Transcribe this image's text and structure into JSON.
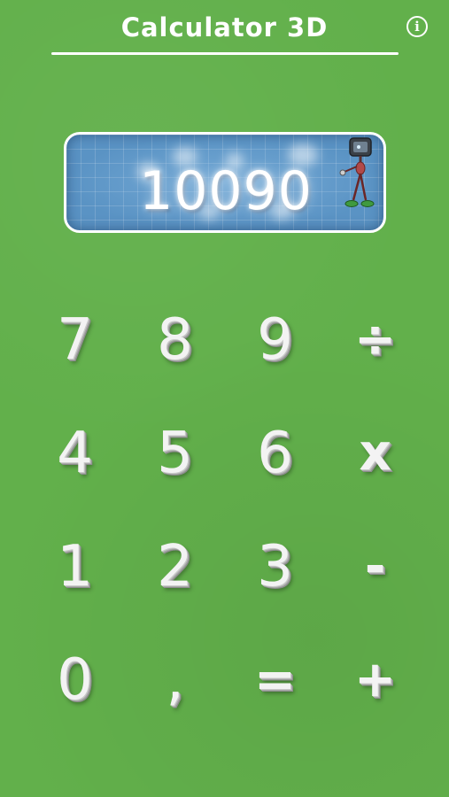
{
  "header": {
    "title": "Calculator 3D",
    "info_label": "i"
  },
  "display": {
    "value": "10090"
  },
  "keypad": {
    "rows": [
      [
        "7",
        "8",
        "9",
        "÷"
      ],
      [
        "4",
        "5",
        "6",
        "x"
      ],
      [
        "1",
        "2",
        "3",
        "-"
      ],
      [
        "0",
        ",",
        "=",
        "+"
      ]
    ]
  },
  "colors": {
    "background": "#62b04b",
    "display_background": "#5a93c4",
    "key_text": "#f3f3f3",
    "header_text": "#ffffff"
  }
}
